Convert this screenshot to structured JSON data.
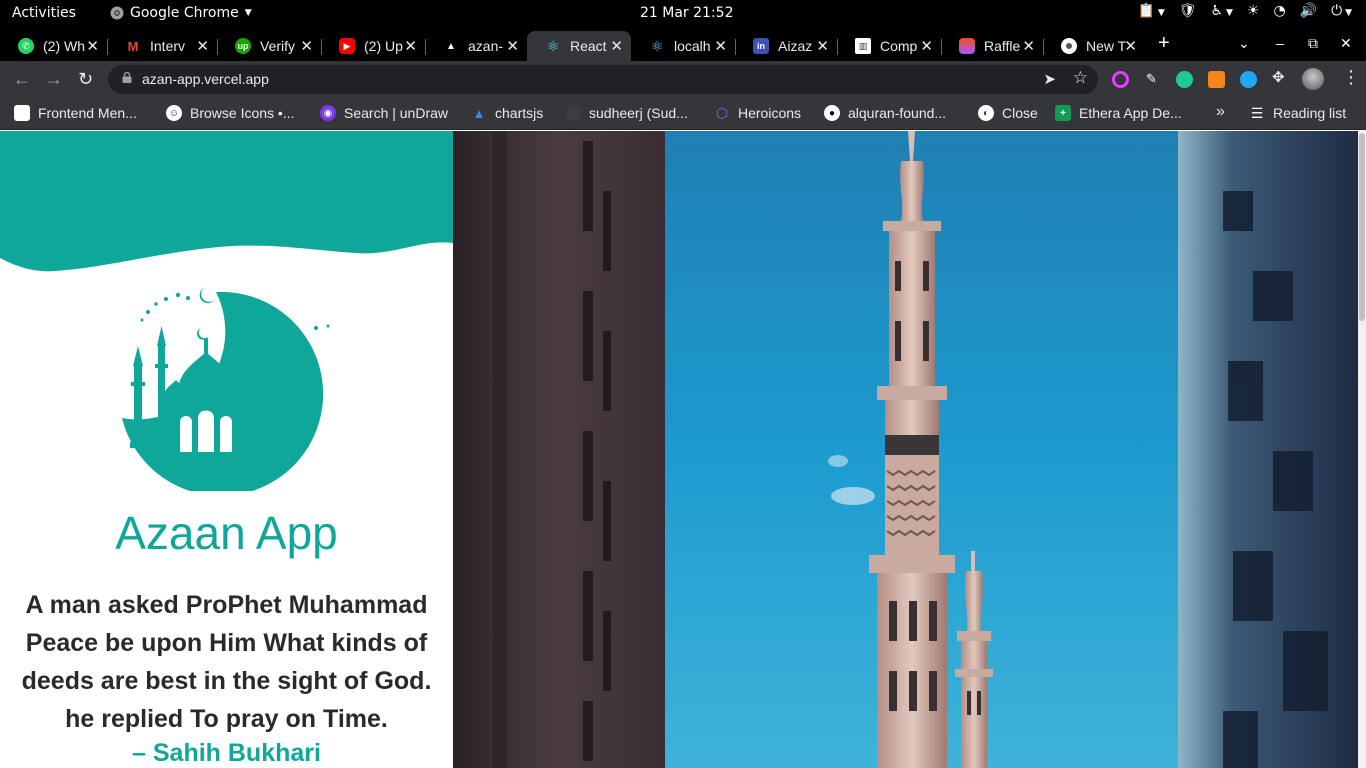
{
  "system": {
    "activities": "Activities",
    "app_name": "Google Chrome",
    "clock": "21 Mar  21:52"
  },
  "tabs": [
    {
      "title": "(2) Wh",
      "icon": "whatsapp-icon",
      "color": "#25d366"
    },
    {
      "title": "Interv",
      "icon": "gmail-icon",
      "color": "#ea4335"
    },
    {
      "title": "Verify",
      "icon": "upwork-icon",
      "color": "#14a800"
    },
    {
      "title": "(2) Up",
      "icon": "youtube-icon",
      "color": "#ff0000"
    },
    {
      "title": "azan-",
      "icon": "vercel-icon",
      "color": "#ffffff"
    },
    {
      "title": "React",
      "icon": "react-icon",
      "color": "#61dafb",
      "active": true
    },
    {
      "title": "localh",
      "icon": "react-icon",
      "color": "#61dafb"
    },
    {
      "title": "Aizaz",
      "icon": "linkedin-icon",
      "color": "#3f51b5"
    },
    {
      "title": "Comp",
      "icon": "trello-icon",
      "color": "#ffffff"
    },
    {
      "title": "Raffle",
      "icon": "figma-icon",
      "color": "#f24e1e"
    },
    {
      "title": "New T",
      "icon": "chrome-icon",
      "color": "#ffffff"
    }
  ],
  "toolbar": {
    "url": "azan-app.vercel.app"
  },
  "bookmarks": [
    {
      "label": "Frontend Men...",
      "icon": "frontend-mentor-icon",
      "color": "#ffffff"
    },
    {
      "label": "Browse Icons •...",
      "icon": "smiley-icon",
      "color": "#ffffff"
    },
    {
      "label": "Search | unDraw",
      "icon": "undraw-icon",
      "color": "#7c3aed"
    },
    {
      "label": "chartsjs",
      "icon": "chartjs-icon",
      "color": "#4285f4"
    },
    {
      "label": "sudheerj (Sud...",
      "icon": "github-icon",
      "color": "#3c3c3c"
    },
    {
      "label": "Heroicons",
      "icon": "heroicons-icon",
      "color": "#8b5cf6"
    },
    {
      "label": "alquran-found...",
      "icon": "github-icon",
      "color": "#ffffff"
    },
    {
      "label": "Close",
      "icon": "globe-icon",
      "color": "#ffffff"
    },
    {
      "label": "Ethera App De...",
      "icon": "sheets-icon",
      "color": "#0f9d58"
    }
  ],
  "reading_list": "Reading list",
  "page": {
    "title": "Azaan App",
    "quote": "A man asked ProPhet Muhammad Peace be upon Him What kinds of deeds are best in the sight of God. he replied To pray on Time.",
    "source": "– Sahih Bukhari",
    "accent_color": "#0fa79a"
  }
}
